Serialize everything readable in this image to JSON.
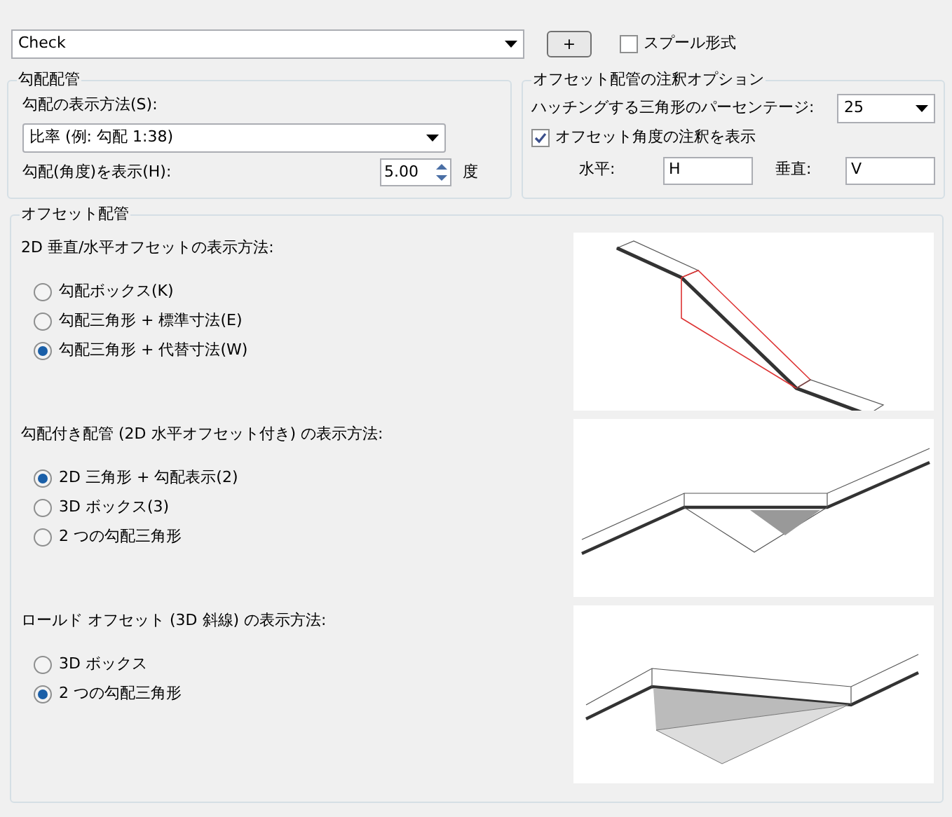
{
  "style_combo": {
    "value": "Check"
  },
  "add_button": {
    "label": "+"
  },
  "spool_format": {
    "label": "スプール形式",
    "checked": false
  },
  "slope_group": {
    "title": "勾配配管",
    "method_label": "勾配の表示方法(S):",
    "method_value": "比率 (例: 勾配 1:38)",
    "angle_label": "勾配(角度)を表示(H):",
    "angle_value": "5.00",
    "angle_unit": "度"
  },
  "annotation_group": {
    "title": "オフセット配管の注釈オプション",
    "hatch_label": "ハッチングする三角形のパーセンテージ:",
    "hatch_value": "25",
    "show_angle": {
      "label": "オフセット角度の注釈を表示",
      "checked": true
    },
    "horizontal_label": "水平:",
    "horizontal_value": "H",
    "vertical_label": "垂直:",
    "vertical_value": "V"
  },
  "offset_group": {
    "title": "オフセット配管",
    "sections": [
      {
        "label": "2D 垂直/水平オフセットの表示方法:",
        "options": [
          {
            "label": "勾配ボックス(K)",
            "selected": false
          },
          {
            "label": "勾配三角形 + 標準寸法(E)",
            "selected": false
          },
          {
            "label": "勾配三角形 + 代替寸法(W)",
            "selected": true
          }
        ]
      },
      {
        "label": "勾配付き配管 (2D 水平オフセット付き) の表示方法:",
        "options": [
          {
            "label": "2D 三角形 + 勾配表示(2)",
            "selected": true
          },
          {
            "label": "3D ボックス(3)",
            "selected": false
          },
          {
            "label": "2 つの勾配三角形",
            "selected": false
          }
        ]
      },
      {
        "label": "ロールド オフセット (3D 斜線) の表示方法:",
        "options": [
          {
            "label": "3D ボックス",
            "selected": false
          },
          {
            "label": "2 つの勾配三角形",
            "selected": true
          }
        ]
      }
    ]
  }
}
